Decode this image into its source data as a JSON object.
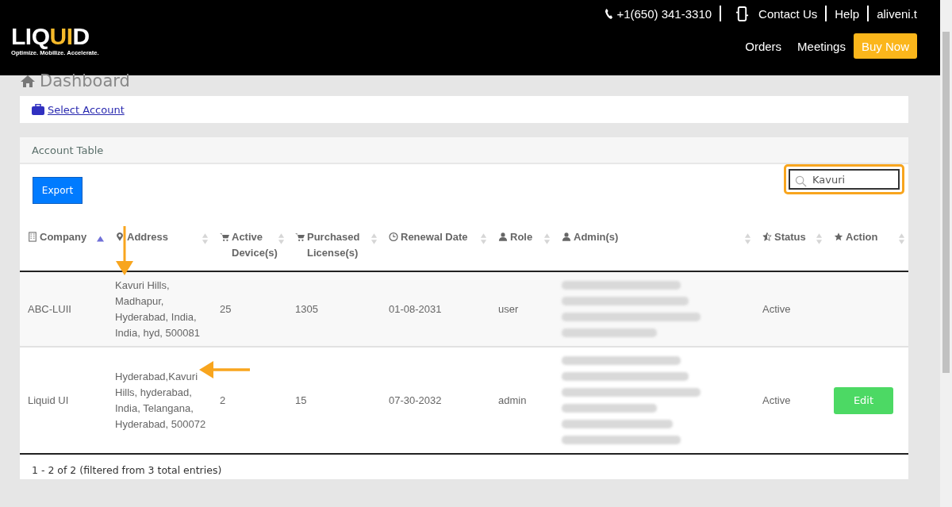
{
  "header": {
    "logo": {
      "wordmark_start": "LIQ",
      "wordmark_accent": "UI",
      "wordmark_end": "D",
      "tagline": "Optimize. Mobilize. Accelerate."
    },
    "top_links": [
      {
        "kind": "phone",
        "label": "+1(650) 341-3310"
      },
      {
        "kind": "contact",
        "label": "Contact Us"
      },
      {
        "kind": "plain",
        "label": "Help"
      },
      {
        "kind": "plain",
        "label": "aliveni.t"
      }
    ],
    "nav": [
      {
        "kind": "link",
        "label": "Orders"
      },
      {
        "kind": "link",
        "label": "Meetings"
      },
      {
        "kind": "cta",
        "label": "Buy Now"
      }
    ]
  },
  "page_title": "Dashboard",
  "account_link": "Select Account",
  "panel": {
    "title": "Account Table",
    "export_button": "Export",
    "search": {
      "value": "Kavuri",
      "highlighted": true
    },
    "columns": [
      {
        "kind": "building",
        "label": "Company",
        "sorted": true
      },
      {
        "kind": "pin",
        "label": "Address",
        "sorted": false
      },
      {
        "kind": "cart",
        "label": "Active Device(s)",
        "sorted": false
      },
      {
        "kind": "cart",
        "label": "Purchased License(s)",
        "sorted": false
      },
      {
        "kind": "clock",
        "label": "Renewal Date",
        "sorted": false
      },
      {
        "kind": "user",
        "label": "Role",
        "sorted": false
      },
      {
        "kind": "user",
        "label": "Admin(s)",
        "sorted": false
      },
      {
        "kind": "half-star",
        "label": "Status",
        "sorted": false
      },
      {
        "kind": "star",
        "label": "Action",
        "sorted": false
      }
    ],
    "rows": [
      {
        "company": "ABC-LUII",
        "address": "Kavuri Hills, Madhapur, Hyderabad, India, India, hyd, 500081",
        "active_devices": "25",
        "purchased_licenses": "1305",
        "renewal_date": "01-08-2031",
        "role": "user",
        "status": "Active",
        "kind": "arrow-down"
      },
      {
        "company": "Liquid UI",
        "address": "Hyderabad,Kavuri Hills, hyderabad, India, Telangana, Hyderabad, 500072",
        "active_devices": "2",
        "purchased_licenses": "15",
        "renewal_date": "07-30-2032",
        "role": "admin",
        "status": "Active",
        "action": "Edit",
        "kind": "arrow-left"
      }
    ],
    "footer": "1 - 2 of 2 (filtered from 3 total entries)"
  }
}
